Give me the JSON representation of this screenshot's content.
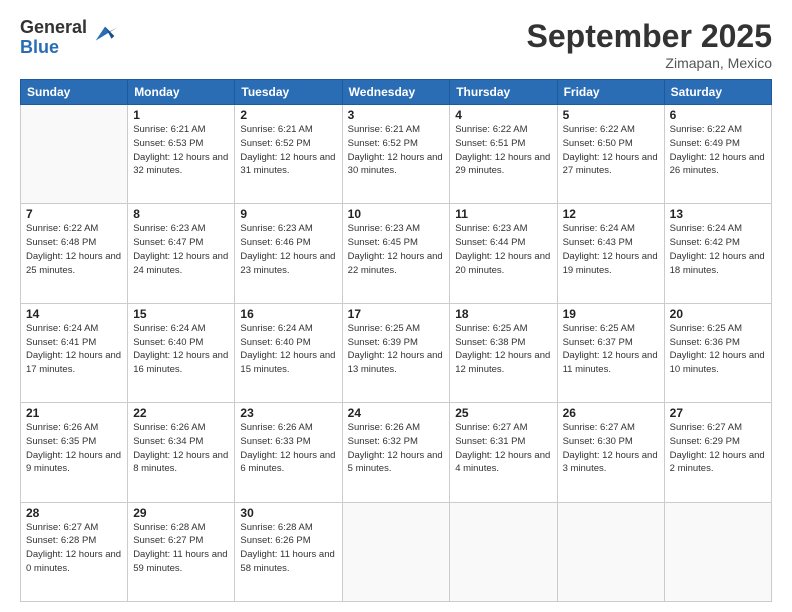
{
  "logo": {
    "general": "General",
    "blue": "Blue"
  },
  "header": {
    "month": "September 2025",
    "location": "Zimapan, Mexico"
  },
  "days_of_week": [
    "Sunday",
    "Monday",
    "Tuesday",
    "Wednesday",
    "Thursday",
    "Friday",
    "Saturday"
  ],
  "weeks": [
    [
      {
        "day": "",
        "info": ""
      },
      {
        "day": "1",
        "info": "Sunrise: 6:21 AM\nSunset: 6:53 PM\nDaylight: 12 hours\nand 32 minutes."
      },
      {
        "day": "2",
        "info": "Sunrise: 6:21 AM\nSunset: 6:52 PM\nDaylight: 12 hours\nand 31 minutes."
      },
      {
        "day": "3",
        "info": "Sunrise: 6:21 AM\nSunset: 6:52 PM\nDaylight: 12 hours\nand 30 minutes."
      },
      {
        "day": "4",
        "info": "Sunrise: 6:22 AM\nSunset: 6:51 PM\nDaylight: 12 hours\nand 29 minutes."
      },
      {
        "day": "5",
        "info": "Sunrise: 6:22 AM\nSunset: 6:50 PM\nDaylight: 12 hours\nand 27 minutes."
      },
      {
        "day": "6",
        "info": "Sunrise: 6:22 AM\nSunset: 6:49 PM\nDaylight: 12 hours\nand 26 minutes."
      }
    ],
    [
      {
        "day": "7",
        "info": "Sunrise: 6:22 AM\nSunset: 6:48 PM\nDaylight: 12 hours\nand 25 minutes."
      },
      {
        "day": "8",
        "info": "Sunrise: 6:23 AM\nSunset: 6:47 PM\nDaylight: 12 hours\nand 24 minutes."
      },
      {
        "day": "9",
        "info": "Sunrise: 6:23 AM\nSunset: 6:46 PM\nDaylight: 12 hours\nand 23 minutes."
      },
      {
        "day": "10",
        "info": "Sunrise: 6:23 AM\nSunset: 6:45 PM\nDaylight: 12 hours\nand 22 minutes."
      },
      {
        "day": "11",
        "info": "Sunrise: 6:23 AM\nSunset: 6:44 PM\nDaylight: 12 hours\nand 20 minutes."
      },
      {
        "day": "12",
        "info": "Sunrise: 6:24 AM\nSunset: 6:43 PM\nDaylight: 12 hours\nand 19 minutes."
      },
      {
        "day": "13",
        "info": "Sunrise: 6:24 AM\nSunset: 6:42 PM\nDaylight: 12 hours\nand 18 minutes."
      }
    ],
    [
      {
        "day": "14",
        "info": "Sunrise: 6:24 AM\nSunset: 6:41 PM\nDaylight: 12 hours\nand 17 minutes."
      },
      {
        "day": "15",
        "info": "Sunrise: 6:24 AM\nSunset: 6:40 PM\nDaylight: 12 hours\nand 16 minutes."
      },
      {
        "day": "16",
        "info": "Sunrise: 6:24 AM\nSunset: 6:40 PM\nDaylight: 12 hours\nand 15 minutes."
      },
      {
        "day": "17",
        "info": "Sunrise: 6:25 AM\nSunset: 6:39 PM\nDaylight: 12 hours\nand 13 minutes."
      },
      {
        "day": "18",
        "info": "Sunrise: 6:25 AM\nSunset: 6:38 PM\nDaylight: 12 hours\nand 12 minutes."
      },
      {
        "day": "19",
        "info": "Sunrise: 6:25 AM\nSunset: 6:37 PM\nDaylight: 12 hours\nand 11 minutes."
      },
      {
        "day": "20",
        "info": "Sunrise: 6:25 AM\nSunset: 6:36 PM\nDaylight: 12 hours\nand 10 minutes."
      }
    ],
    [
      {
        "day": "21",
        "info": "Sunrise: 6:26 AM\nSunset: 6:35 PM\nDaylight: 12 hours\nand 9 minutes."
      },
      {
        "day": "22",
        "info": "Sunrise: 6:26 AM\nSunset: 6:34 PM\nDaylight: 12 hours\nand 8 minutes."
      },
      {
        "day": "23",
        "info": "Sunrise: 6:26 AM\nSunset: 6:33 PM\nDaylight: 12 hours\nand 6 minutes."
      },
      {
        "day": "24",
        "info": "Sunrise: 6:26 AM\nSunset: 6:32 PM\nDaylight: 12 hours\nand 5 minutes."
      },
      {
        "day": "25",
        "info": "Sunrise: 6:27 AM\nSunset: 6:31 PM\nDaylight: 12 hours\nand 4 minutes."
      },
      {
        "day": "26",
        "info": "Sunrise: 6:27 AM\nSunset: 6:30 PM\nDaylight: 12 hours\nand 3 minutes."
      },
      {
        "day": "27",
        "info": "Sunrise: 6:27 AM\nSunset: 6:29 PM\nDaylight: 12 hours\nand 2 minutes."
      }
    ],
    [
      {
        "day": "28",
        "info": "Sunrise: 6:27 AM\nSunset: 6:28 PM\nDaylight: 12 hours\nand 0 minutes."
      },
      {
        "day": "29",
        "info": "Sunrise: 6:28 AM\nSunset: 6:27 PM\nDaylight: 11 hours\nand 59 minutes."
      },
      {
        "day": "30",
        "info": "Sunrise: 6:28 AM\nSunset: 6:26 PM\nDaylight: 11 hours\nand 58 minutes."
      },
      {
        "day": "",
        "info": ""
      },
      {
        "day": "",
        "info": ""
      },
      {
        "day": "",
        "info": ""
      },
      {
        "day": "",
        "info": ""
      }
    ]
  ]
}
